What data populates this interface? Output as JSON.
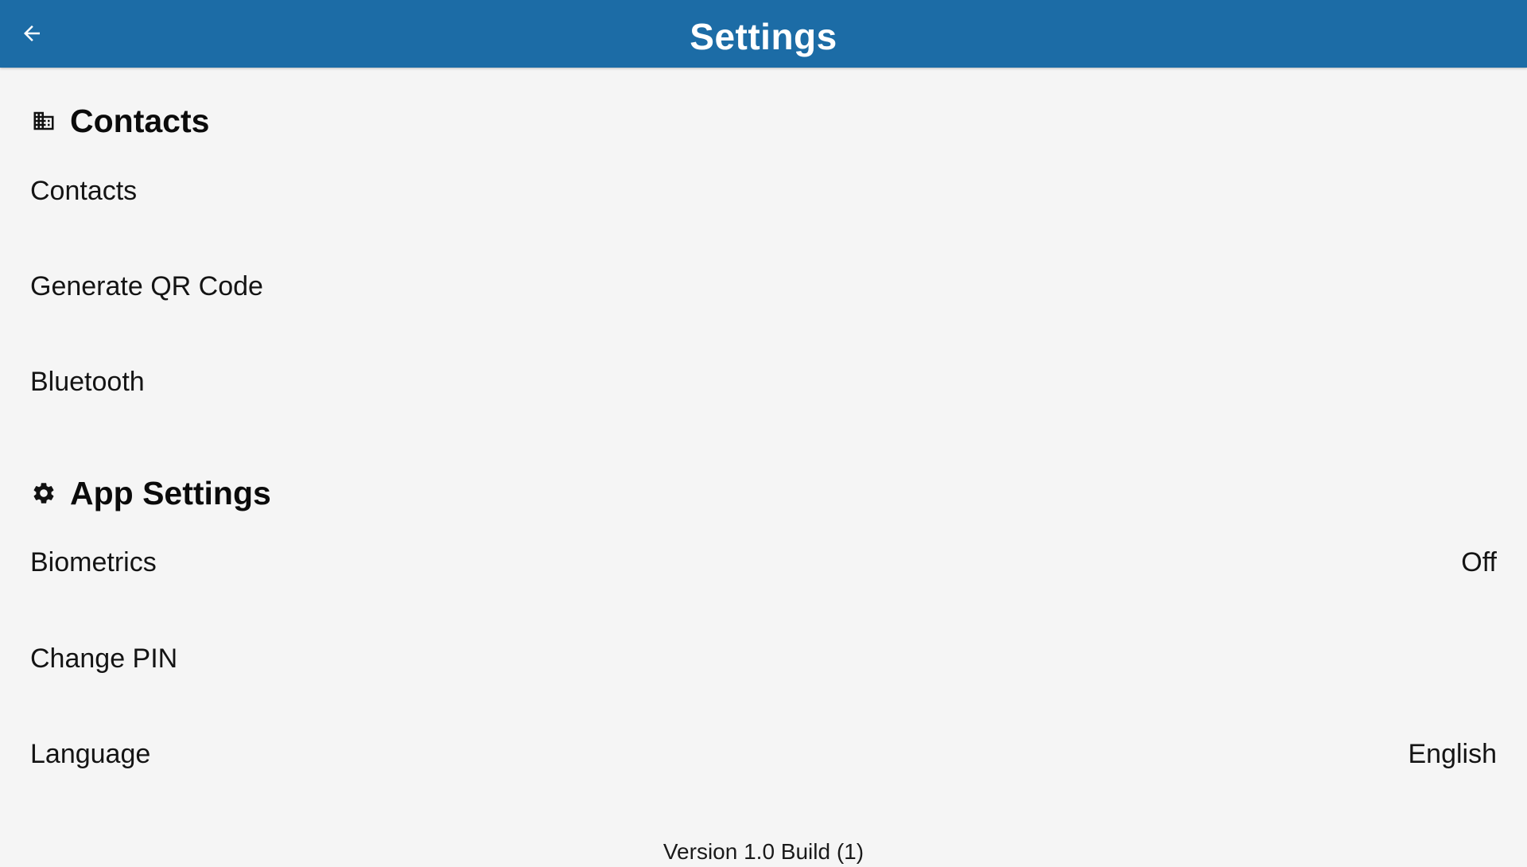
{
  "app_bar": {
    "title": "Settings",
    "background_color": "#1c6ca6",
    "back_icon": "arrow-left-icon"
  },
  "sections": [
    {
      "title": "Contacts",
      "icon": "building-icon",
      "items": [
        {
          "label": "Contacts",
          "value": ""
        },
        {
          "label": "Generate QR Code",
          "value": ""
        },
        {
          "label": "Bluetooth",
          "value": ""
        }
      ]
    },
    {
      "title": "App Settings",
      "icon": "gear-icon",
      "items": [
        {
          "label": "Biometrics",
          "value": "Off"
        },
        {
          "label": "Change PIN",
          "value": ""
        },
        {
          "label": "Language",
          "value": "English"
        }
      ]
    }
  ],
  "footer": {
    "version": "Version 1.0 Build (1)"
  }
}
